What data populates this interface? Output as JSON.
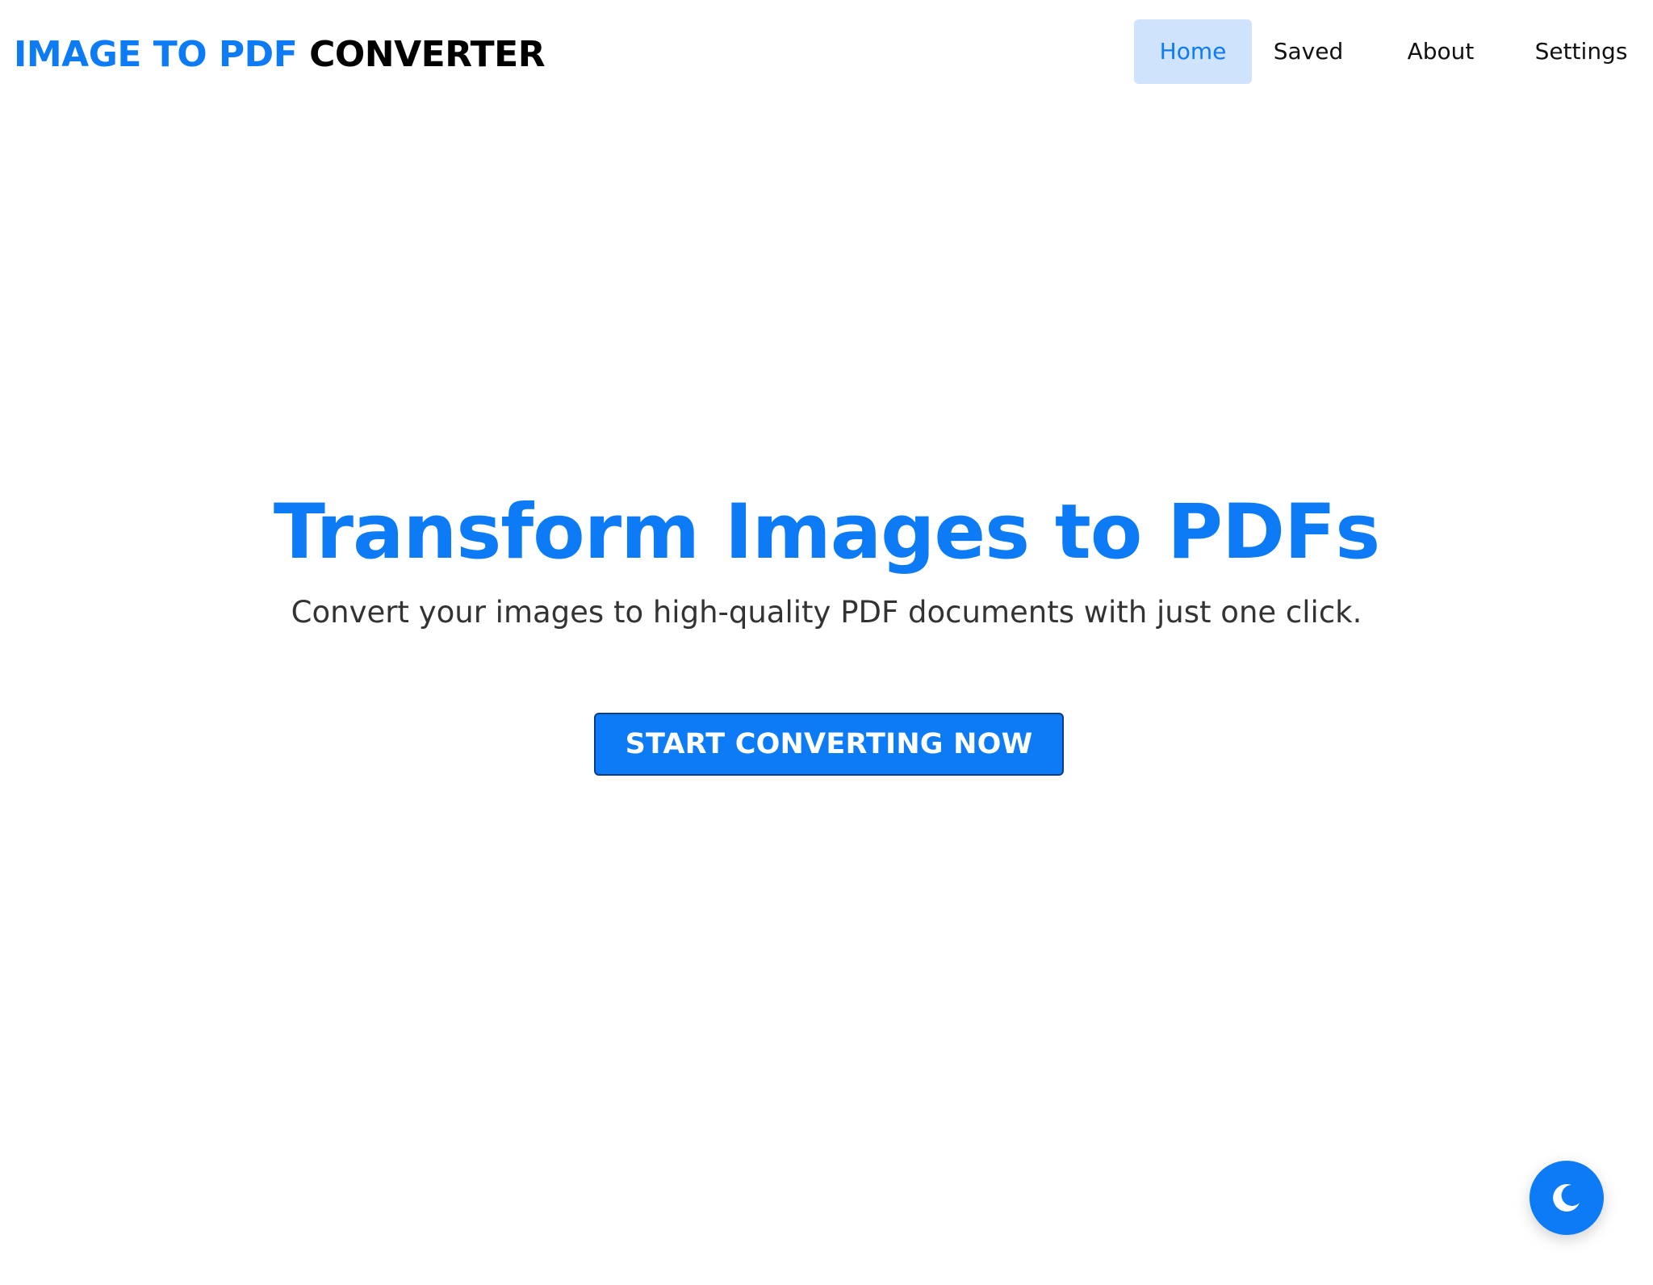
{
  "header": {
    "brand_accent": "IMAGE TO PDF",
    "brand_rest": "CONVERTER",
    "nav": [
      {
        "label": "Home",
        "active": true
      },
      {
        "label": "Saved",
        "active": false
      },
      {
        "label": "About",
        "active": false
      },
      {
        "label": "Settings",
        "active": false
      }
    ]
  },
  "hero": {
    "title": "Transform Images to PDFs",
    "subtitle": "Convert your images to high-quality PDF documents with just one click.",
    "cta_label": "START CONVERTING NOW"
  },
  "theme_toggle": {
    "icon": "moon-icon"
  },
  "colors": {
    "accent": "#0d7bf5",
    "nav_active_bg": "#cfe3fc",
    "text_dark": "#000000",
    "text_muted": "#333333"
  }
}
